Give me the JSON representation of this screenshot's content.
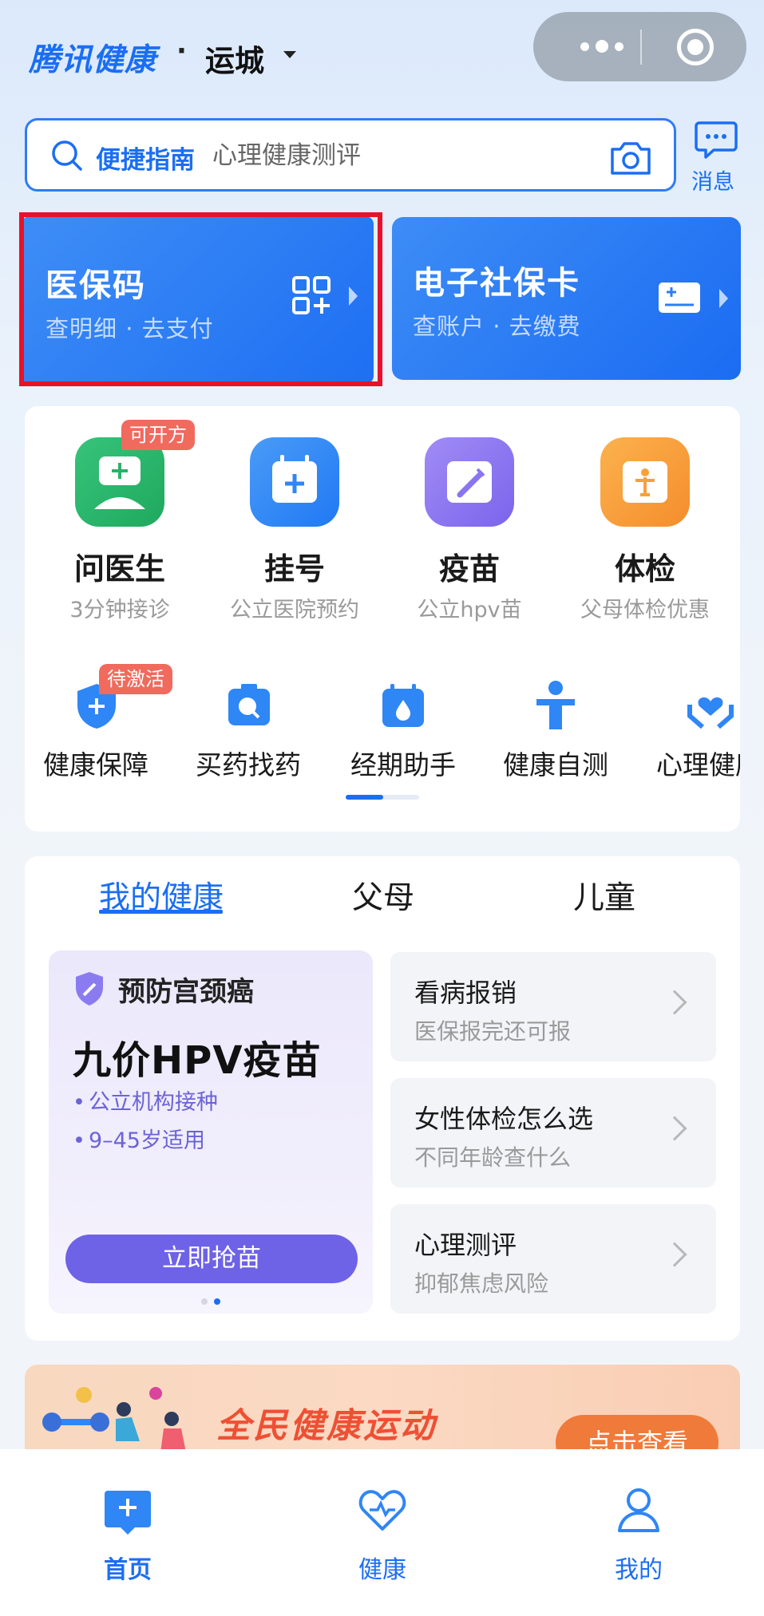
{
  "header": {
    "brand": "腾讯健康",
    "dot": "·",
    "city": "运城"
  },
  "search": {
    "guide_label": "便捷指南",
    "placeholder": "心理健康测评",
    "message_label": "消息"
  },
  "cards": {
    "medical_code": {
      "title": "医保码",
      "subtitle": "查明细 · 去支付"
    },
    "social_card": {
      "title": "电子社保卡",
      "subtitle": "查账户 · 去缴费"
    }
  },
  "services": [
    {
      "name": "问医生",
      "desc": "3分钟接诊",
      "tag": "可开方",
      "icon": "doctor-icon",
      "color": "#27b36a"
    },
    {
      "name": "挂号",
      "desc": "公立医院预约",
      "icon": "calendar-plus-icon",
      "color": "#2f86f5"
    },
    {
      "name": "疫苗",
      "desc": "公立hpv苗",
      "icon": "vaccine-icon",
      "color": "#8a74f0"
    },
    {
      "name": "体检",
      "desc": "父母体检优惠",
      "icon": "checkup-icon",
      "color": "#f7a03c"
    }
  ],
  "mini_services": [
    {
      "name": "健康保障",
      "tag": "待激活",
      "icon": "shield-plus-icon"
    },
    {
      "name": "买药找药",
      "icon": "medicine-search-icon"
    },
    {
      "name": "经期助手",
      "icon": "period-calendar-icon"
    },
    {
      "name": "健康自测",
      "icon": "person-icon"
    },
    {
      "name": "心理健康",
      "icon": "heart-hands-icon"
    }
  ],
  "health_tabs": [
    "我的健康",
    "父母",
    "儿童"
  ],
  "promo": {
    "tag": "预防宫颈癌",
    "title": "九价HPV疫苗",
    "bullets": [
      "公立机构接种",
      "9–45岁适用"
    ],
    "button": "立即抢苗"
  },
  "quick_rows": [
    {
      "title": "看病报销",
      "sub": "医保报完还可报"
    },
    {
      "title": "女性体检怎么选",
      "sub": "不同年龄查什么"
    },
    {
      "title": "心理测评",
      "sub": "抑郁焦虑风险"
    }
  ],
  "banner": {
    "text": "全民健康运动",
    "button": "点击查看"
  },
  "tabbar": [
    {
      "label": "首页",
      "active": true
    },
    {
      "label": "健康",
      "active": false
    },
    {
      "label": "我的",
      "active": false
    }
  ],
  "colors": {
    "primary": "#1b6ef3",
    "highlight_border": "#e8112b",
    "promo_button": "#6e62e6",
    "banner_text": "#ee5034"
  }
}
